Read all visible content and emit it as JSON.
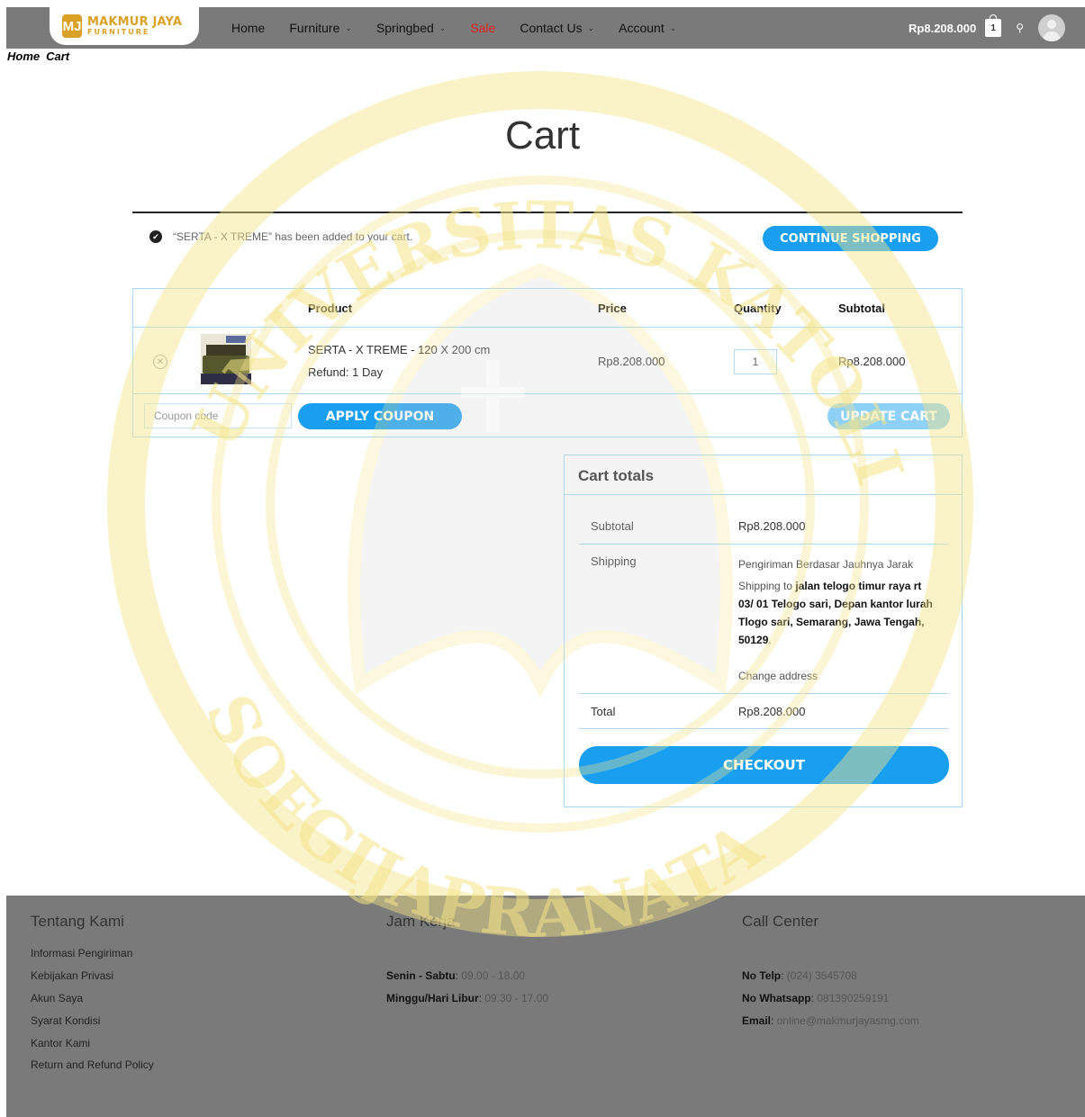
{
  "header": {
    "logo_line1": "MAKMUR JAYA",
    "logo_line2": "FURNITURE",
    "logo_mark": "MJ",
    "nav": [
      {
        "label": "Home",
        "has_dropdown": false
      },
      {
        "label": "Furniture",
        "has_dropdown": true
      },
      {
        "label": "Springbed",
        "has_dropdown": true
      },
      {
        "label": "Sale",
        "has_dropdown": false
      },
      {
        "label": "Contact Us",
        "has_dropdown": true
      },
      {
        "label": "Account",
        "has_dropdown": true
      }
    ],
    "cart_total": "Rp8.208.000",
    "cart_count": "1",
    "search_icon": "search-icon",
    "avatar_icon": "user-avatar-icon"
  },
  "breadcrumb": [
    "Home",
    "Cart"
  ],
  "page_title": "Cart",
  "notice": {
    "text": "“SERTA - X TREME” has been added to your cart.",
    "button": "CONTINUE SHOPPING"
  },
  "cart_table": {
    "headers": {
      "product": "Product",
      "price": "Price",
      "quantity": "Quantity",
      "subtotal": "Subtotal"
    },
    "items": [
      {
        "name": "SERTA - X TREME - 120 X 200 cm",
        "meta": "Refund: 1 Day",
        "price": "Rp8.208.000",
        "quantity": "1",
        "subtotal": "Rp8.208.000"
      }
    ],
    "coupon_placeholder": "Coupon code",
    "apply_coupon": "APPLY COUPON",
    "update_cart": "UPDATE CART"
  },
  "totals": {
    "title": "Cart totals",
    "subtotal_label": "Subtotal",
    "subtotal_value": "Rp8.208.000",
    "shipping_label": "Shipping",
    "shipping_method": "Pengiriman Berdasar Jauhnya Jarak",
    "shipping_to_prefix": "Shipping to ",
    "shipping_address": "jalan telogo timur raya rt 03/ 01 Telogo sari, Depan kantor lurah Tlogo sari, Semarang, Jawa Tengah, 50129",
    "change_address": "Change address",
    "total_label": "Total",
    "total_value": "Rp8.208.000",
    "checkout": "CHECKOUT"
  },
  "footer": {
    "col1": {
      "title": "Tentang Kami",
      "links": [
        "Informasi Pengiriman",
        "Kebijakan Privasi",
        "Akun Saya",
        "Syarat Kondisi",
        "Kantor Kami",
        "Return and Refund Policy"
      ]
    },
    "col2": {
      "title": "Jam Kerja",
      "lines": [
        {
          "label": "Senin - Sabtu",
          "value": "09.00 - 18.00"
        },
        {
          "label": "Minggu/Hari Libur",
          "value": "09.30 - 17.00"
        }
      ]
    },
    "col3": {
      "title": "Call Center",
      "lines": [
        {
          "label": "No Telp",
          "value": "(024) 3545708"
        },
        {
          "label": "No Whatsapp",
          "value": "081390259191"
        },
        {
          "label": "Email",
          "value": "online@makmurjayasmg.com"
        }
      ]
    }
  },
  "watermark": {
    "top_text": "UNIVERSITAS KATOLIK",
    "bottom_text": "SOEGIJAPRANATA",
    "color": "#f5e48a"
  },
  "colors": {
    "accent": "#1a9ff0",
    "header_bg": "#7a7a7a",
    "sale": "#e0221e",
    "logo_gold": "#d9a126"
  }
}
